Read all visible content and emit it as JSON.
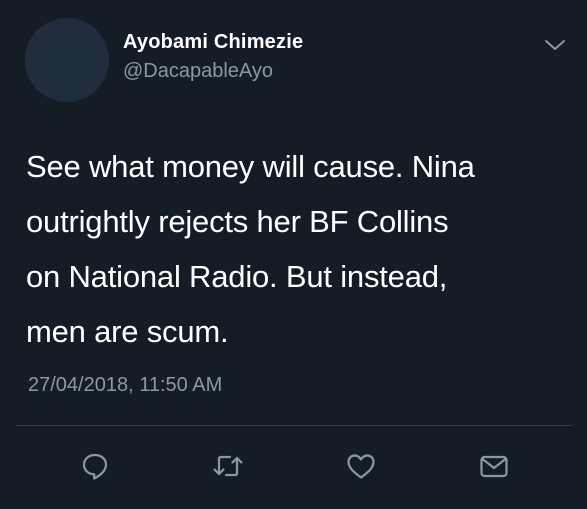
{
  "tweet": {
    "display_name": "Ayobami Chimezie",
    "handle": "@DacapableAyo",
    "text_lines": [
      "See what money will cause. Nina",
      "outrightly rejects her BF Collins",
      "on National Radio. But instead,",
      "men are scum."
    ],
    "timestamp": "27/04/2018, 11:50 AM"
  },
  "icons": {
    "menu": "chevron-down-icon",
    "reply": "reply-icon",
    "retweet": "retweet-icon",
    "like": "heart-icon",
    "message": "mail-icon"
  },
  "colors": {
    "background": "#141d26",
    "primary_text": "#ffffff",
    "secondary_text": "#8899a6",
    "icon": "#8899a6"
  }
}
